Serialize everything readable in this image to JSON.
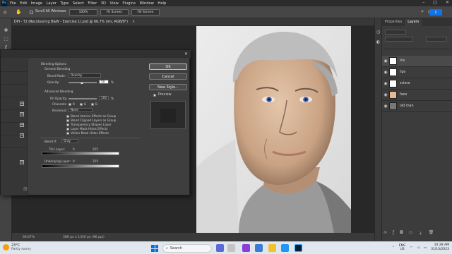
{
  "menu": {
    "logo": "Ps",
    "items": [
      "File",
      "Edit",
      "Image",
      "Layer",
      "Type",
      "Select",
      "Filter",
      "3D",
      "View",
      "Plugins",
      "Window",
      "Help"
    ]
  },
  "options_bar": {
    "scroll_all": "Scroll All Windows",
    "zoom": "100%",
    "fit_screen": "Fit Screen",
    "fill_screen": "Fill Screen"
  },
  "document": {
    "tab_title": "DPI - T2 (Recolouring B&W - Exercise 1).psd @ 66.7% (iris, RGB/8*)",
    "zoom_status": "66.67%",
    "dims_status": "586 px x 1350 px (96 ppi)"
  },
  "right_panel": {
    "tabs": [
      "Properties",
      "Layers"
    ],
    "layers": [
      {
        "name": "iris"
      },
      {
        "name": "lips"
      },
      {
        "name": "sclera"
      },
      {
        "name": "face"
      },
      {
        "name": "old man"
      }
    ]
  },
  "dialog": {
    "section": "Blending Options",
    "general": "General Blending",
    "blend_mode_label": "Blend Mode:",
    "blend_mode_value": "Overlay",
    "opacity_label": "Opacity:",
    "opacity_value": "50",
    "opacity_unit": "%",
    "advanced": "Advanced Blending",
    "fill_opacity_label": "Fill Opacity:",
    "fill_opacity_value": "100",
    "channels_label": "Channels:",
    "channels": [
      "R",
      "G",
      "B"
    ],
    "knockout_label": "Knockout:",
    "knockout_value": "None",
    "options": [
      "Blend Interior Effects as Group",
      "Blend Clipped Layers as Group",
      "Transparency Shapes Layer",
      "Layer Mask Hides Effects",
      "Vector Mask Hides Effects"
    ],
    "blend_if_label": "Blend If:",
    "blend_if_value": "Gray",
    "this_layer_label": "This Layer:",
    "this_layer_min": "0",
    "this_layer_max": "255",
    "underlying_label": "Underlying Layer:",
    "underlying_min": "0",
    "underlying_max": "255",
    "ok": "OK",
    "cancel": "Cancel",
    "new_style": "New Style...",
    "preview": "Preview"
  },
  "taskbar": {
    "temp": "23°C",
    "weather": "Partly sunny",
    "search": "Search",
    "lang": "ENG",
    "region": "US",
    "time": "10:28 AM",
    "date": "31/10/2023"
  }
}
